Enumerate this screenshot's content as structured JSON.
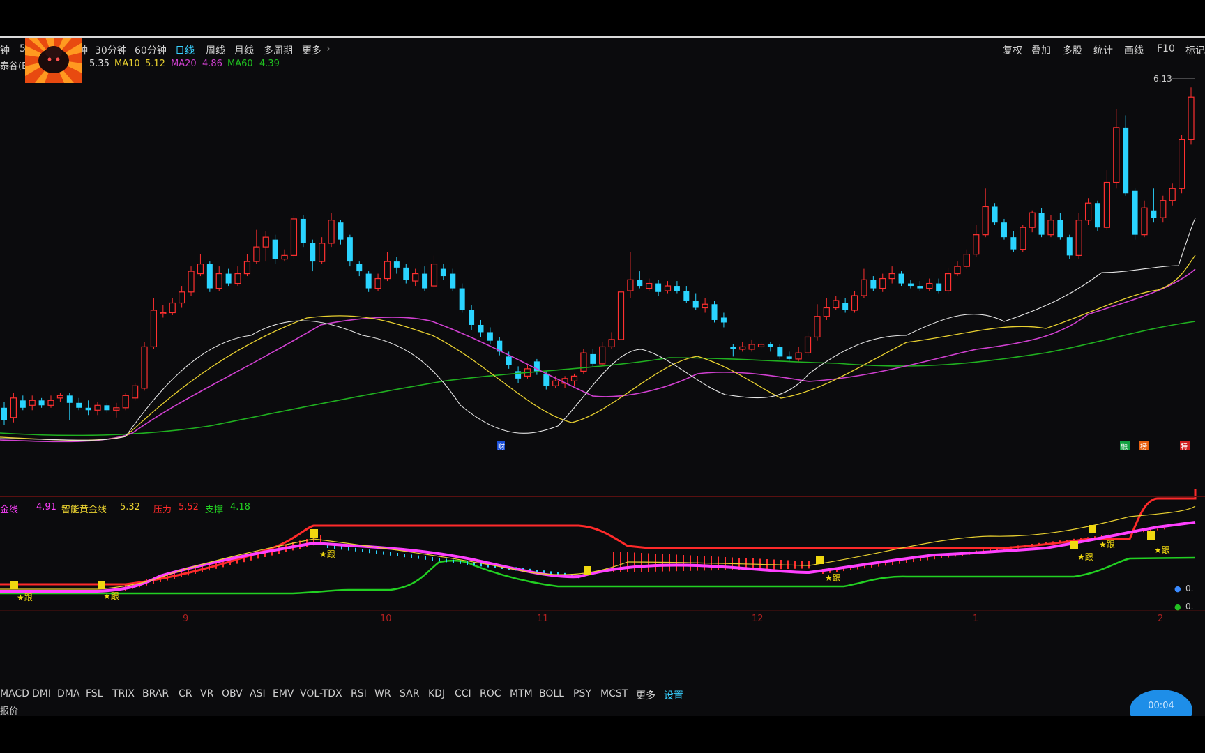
{
  "period_bar": {
    "items": [
      {
        "label": "钟",
        "active": false
      },
      {
        "label": "5",
        "active": false
      },
      {
        "label": "钟",
        "active": false
      },
      {
        "label": "30分钟",
        "active": false
      },
      {
        "label": "60分钟",
        "active": false
      },
      {
        "label": "日线",
        "active": true
      },
      {
        "label": "周线",
        "active": false
      },
      {
        "label": "月线",
        "active": false
      },
      {
        "label": "多周期",
        "active": false
      },
      {
        "label": "更多",
        "active": false
      }
    ],
    "more_arrow": "›"
  },
  "right_toolbar": {
    "items": [
      "复权",
      "叠加",
      "多股",
      "统计",
      "画线",
      "F10",
      "标记"
    ]
  },
  "ma_legend": {
    "stock_fragment": "泰谷(E",
    "ma5_value": "5.35",
    "ma10_label": "MA10",
    "ma10_value": "5.12",
    "ma20_label": "MA20",
    "ma20_value": "4.86",
    "ma60_label": "MA60",
    "ma60_value": "4.39"
  },
  "price_high_label": "6.13",
  "event_flags": {
    "f1": "财",
    "f2": "融",
    "f3": "榜",
    "f4": "特"
  },
  "indicator_legend": {
    "l1": "金线",
    "v1": "4.91",
    "l2": "智能黄金线",
    "v2": "5.32",
    "l3": "压力",
    "v3": "5.52",
    "l4": "支撑",
    "v4": "4.18"
  },
  "indicator_marks": {
    "follow_label": "★跟"
  },
  "right_readouts": [
    "0.",
    "0."
  ],
  "x_axis": {
    "labels": [
      {
        "text": "9",
        "month": 9
      },
      {
        "text": "10",
        "month": 10
      },
      {
        "text": "11",
        "month": 11
      },
      {
        "text": "12",
        "month": 12
      },
      {
        "text": "1",
        "month": 1
      },
      {
        "text": "2",
        "month": 2
      }
    ]
  },
  "indicator_tabs": {
    "tabs": [
      "MACD",
      "DMI",
      "DMA",
      "FSL",
      "TRIX",
      "BRAR",
      "CR",
      "VR",
      "OBV",
      "ASI",
      "EMV",
      "VOL-TDX",
      "RSI",
      "WR",
      "SAR",
      "KDJ",
      "CCI",
      "ROC",
      "MTM",
      "BOLL",
      "PSY",
      "MCST",
      "更多"
    ],
    "settings_label": "设置"
  },
  "bottom_text": "报价",
  "timer_text": "00:04",
  "colors": {
    "up": "#ff3030",
    "down": "#2ad4ff",
    "ma5": "#e0e0e0",
    "ma10": "#e8d030",
    "ma20": "#d040d0",
    "ma60": "#20b020",
    "accent": "#38d0ff"
  },
  "chart_data": {
    "type": "candlestick",
    "price_range": [
      3.35,
      6.2
    ],
    "candles": [
      [
        3.5,
        3.4,
        3.55,
        3.36
      ],
      [
        3.42,
        3.58,
        3.62,
        3.38
      ],
      [
        3.56,
        3.5,
        3.6,
        3.48
      ],
      [
        3.52,
        3.56,
        3.6,
        3.48
      ],
      [
        3.56,
        3.52,
        3.58,
        3.5
      ],
      [
        3.52,
        3.56,
        3.6,
        3.5
      ],
      [
        3.58,
        3.6,
        3.62,
        3.55
      ],
      [
        3.6,
        3.54,
        3.62,
        3.4
      ],
      [
        3.54,
        3.5,
        3.58,
        3.48
      ],
      [
        3.5,
        3.48,
        3.56,
        3.44
      ],
      [
        3.48,
        3.52,
        3.55,
        3.44
      ],
      [
        3.52,
        3.48,
        3.54,
        3.46
      ],
      [
        3.48,
        3.5,
        3.54,
        3.42
      ],
      [
        3.5,
        3.6,
        3.62,
        3.48
      ],
      [
        3.58,
        3.68,
        3.7,
        3.56
      ],
      [
        3.66,
        4.0,
        4.04,
        3.64
      ],
      [
        4.0,
        4.3,
        4.4,
        3.98
      ],
      [
        4.28,
        4.28,
        4.34,
        4.24
      ],
      [
        4.28,
        4.36,
        4.4,
        4.26
      ],
      [
        4.36,
        4.45,
        4.5,
        4.32
      ],
      [
        4.45,
        4.62,
        4.66,
        4.42
      ],
      [
        4.6,
        4.68,
        4.76,
        4.58
      ],
      [
        4.68,
        4.48,
        4.7,
        4.45
      ],
      [
        4.48,
        4.6,
        4.66,
        4.46
      ],
      [
        4.6,
        4.52,
        4.64,
        4.5
      ],
      [
        4.52,
        4.6,
        4.66,
        4.5
      ],
      [
        4.6,
        4.7,
        4.76,
        4.58
      ],
      [
        4.7,
        4.82,
        4.96,
        4.68
      ],
      [
        4.82,
        4.9,
        4.95,
        4.7
      ],
      [
        4.88,
        4.72,
        4.92,
        4.68
      ],
      [
        4.72,
        4.75,
        4.8,
        4.7
      ],
      [
        4.75,
        5.05,
        5.08,
        4.72
      ],
      [
        5.05,
        4.85,
        5.08,
        4.82
      ],
      [
        4.85,
        4.7,
        4.88,
        4.62
      ],
      [
        4.7,
        4.85,
        4.9,
        4.68
      ],
      [
        4.85,
        5.04,
        5.1,
        4.82
      ],
      [
        5.02,
        4.88,
        5.04,
        4.84
      ],
      [
        4.9,
        4.7,
        4.92,
        4.66
      ],
      [
        4.68,
        4.62,
        4.7,
        4.58
      ],
      [
        4.6,
        4.48,
        4.62,
        4.45
      ],
      [
        4.48,
        4.56,
        4.6,
        4.46
      ],
      [
        4.56,
        4.7,
        4.78,
        4.54
      ],
      [
        4.7,
        4.65,
        4.74,
        4.6
      ],
      [
        4.65,
        4.55,
        4.68,
        4.52
      ],
      [
        4.54,
        4.6,
        4.64,
        4.5
      ],
      [
        4.6,
        4.48,
        4.66,
        4.46
      ],
      [
        4.5,
        4.68,
        4.75,
        4.48
      ],
      [
        4.64,
        4.58,
        4.68,
        4.55
      ],
      [
        4.6,
        4.48,
        4.64,
        4.46
      ],
      [
        4.48,
        4.3,
        4.52,
        4.28
      ],
      [
        4.3,
        4.18,
        4.34,
        4.14
      ],
      [
        4.18,
        4.12,
        4.22,
        4.08
      ],
      [
        4.12,
        4.05,
        4.16,
        4.02
      ],
      [
        4.05,
        3.96,
        4.08,
        3.93
      ],
      [
        3.92,
        3.85,
        3.96,
        3.82
      ],
      [
        3.8,
        3.74,
        3.84,
        3.7
      ],
      [
        3.76,
        3.82,
        3.86,
        3.74
      ],
      [
        3.88,
        3.8,
        3.9,
        3.77
      ],
      [
        3.78,
        3.68,
        3.8,
        3.65
      ],
      [
        3.68,
        3.72,
        3.76,
        3.66
      ],
      [
        3.7,
        3.74,
        3.76,
        3.66
      ],
      [
        3.72,
        3.76,
        3.78,
        3.68
      ],
      [
        3.8,
        3.95,
        3.98,
        3.78
      ],
      [
        3.94,
        3.86,
        3.98,
        3.84
      ],
      [
        3.86,
        4.0,
        4.04,
        3.84
      ],
      [
        4.0,
        4.06,
        4.12,
        3.98
      ],
      [
        4.06,
        4.45,
        4.52,
        4.04
      ],
      [
        4.46,
        4.55,
        4.78,
        4.4
      ],
      [
        4.55,
        4.5,
        4.62,
        4.48
      ],
      [
        4.48,
        4.52,
        4.56,
        4.46
      ],
      [
        4.52,
        4.45,
        4.55,
        4.42
      ],
      [
        4.46,
        4.5,
        4.54,
        4.44
      ],
      [
        4.5,
        4.46,
        4.54,
        4.44
      ],
      [
        4.46,
        4.38,
        4.5,
        4.36
      ],
      [
        4.38,
        4.32,
        4.44,
        4.3
      ],
      [
        4.32,
        4.35,
        4.4,
        4.28
      ],
      [
        4.35,
        4.22,
        4.38,
        4.2
      ],
      [
        4.24,
        4.2,
        4.28,
        4.16
      ],
      [
        4.0,
        3.98,
        4.02,
        3.92
      ],
      [
        3.98,
        4.0,
        4.04,
        3.96
      ],
      [
        3.98,
        4.02,
        4.06,
        3.96
      ],
      [
        4.0,
        4.02,
        4.04,
        3.98
      ],
      [
        4.02,
        4.0,
        4.04,
        3.96
      ],
      [
        4.0,
        3.92,
        4.02,
        3.9
      ],
      [
        3.92,
        3.9,
        3.96,
        3.88
      ],
      [
        3.9,
        3.95,
        4.0,
        3.88
      ],
      [
        3.95,
        4.08,
        4.12,
        3.92
      ],
      [
        4.08,
        4.25,
        4.35,
        4.05
      ],
      [
        4.25,
        4.32,
        4.4,
        4.22
      ],
      [
        4.32,
        4.38,
        4.42,
        4.3
      ],
      [
        4.36,
        4.3,
        4.4,
        4.28
      ],
      [
        4.3,
        4.42,
        4.46,
        4.28
      ],
      [
        4.42,
        4.55,
        4.64,
        4.4
      ],
      [
        4.55,
        4.48,
        4.58,
        4.46
      ],
      [
        4.48,
        4.56,
        4.6,
        4.45
      ],
      [
        4.56,
        4.6,
        4.66,
        4.52
      ],
      [
        4.6,
        4.52,
        4.62,
        4.5
      ],
      [
        4.52,
        4.5,
        4.55,
        4.48
      ],
      [
        4.5,
        4.48,
        4.54,
        4.46
      ],
      [
        4.48,
        4.52,
        4.56,
        4.46
      ],
      [
        4.52,
        4.46,
        4.56,
        4.44
      ],
      [
        4.46,
        4.6,
        4.65,
        4.44
      ],
      [
        4.6,
        4.66,
        4.7,
        4.58
      ],
      [
        4.66,
        4.76,
        4.8,
        4.64
      ],
      [
        4.76,
        4.92,
        5.0,
        4.74
      ],
      [
        4.92,
        5.15,
        5.3,
        4.9
      ],
      [
        5.15,
        5.02,
        5.18,
        5.0
      ],
      [
        5.02,
        4.9,
        5.05,
        4.88
      ],
      [
        4.9,
        4.8,
        4.95,
        4.78
      ],
      [
        4.8,
        4.98,
        5.0,
        4.78
      ],
      [
        4.98,
        5.1,
        5.12,
        4.94
      ],
      [
        5.1,
        4.92,
        5.14,
        4.9
      ],
      [
        4.92,
        5.04,
        5.08,
        4.9
      ],
      [
        5.04,
        4.9,
        5.1,
        4.88
      ],
      [
        4.9,
        4.75,
        4.92,
        4.72
      ],
      [
        4.75,
        5.04,
        5.1,
        4.72
      ],
      [
        5.04,
        5.18,
        5.22,
        5.0
      ],
      [
        5.18,
        4.98,
        5.2,
        4.95
      ],
      [
        4.98,
        5.35,
        5.45,
        4.96
      ],
      [
        5.35,
        5.8,
        5.95,
        5.3
      ],
      [
        5.8,
        5.26,
        5.9,
        5.24
      ],
      [
        5.28,
        4.92,
        5.3,
        4.88
      ],
      [
        4.92,
        5.14,
        5.2,
        4.9
      ],
      [
        5.12,
        5.06,
        5.3,
        5.02
      ],
      [
        5.06,
        5.2,
        5.24,
        5.02
      ],
      [
        5.2,
        5.3,
        5.34,
        5.16
      ],
      [
        5.3,
        5.7,
        5.74,
        5.26
      ],
      [
        5.7,
        6.05,
        6.13,
        5.66
      ]
    ]
  }
}
